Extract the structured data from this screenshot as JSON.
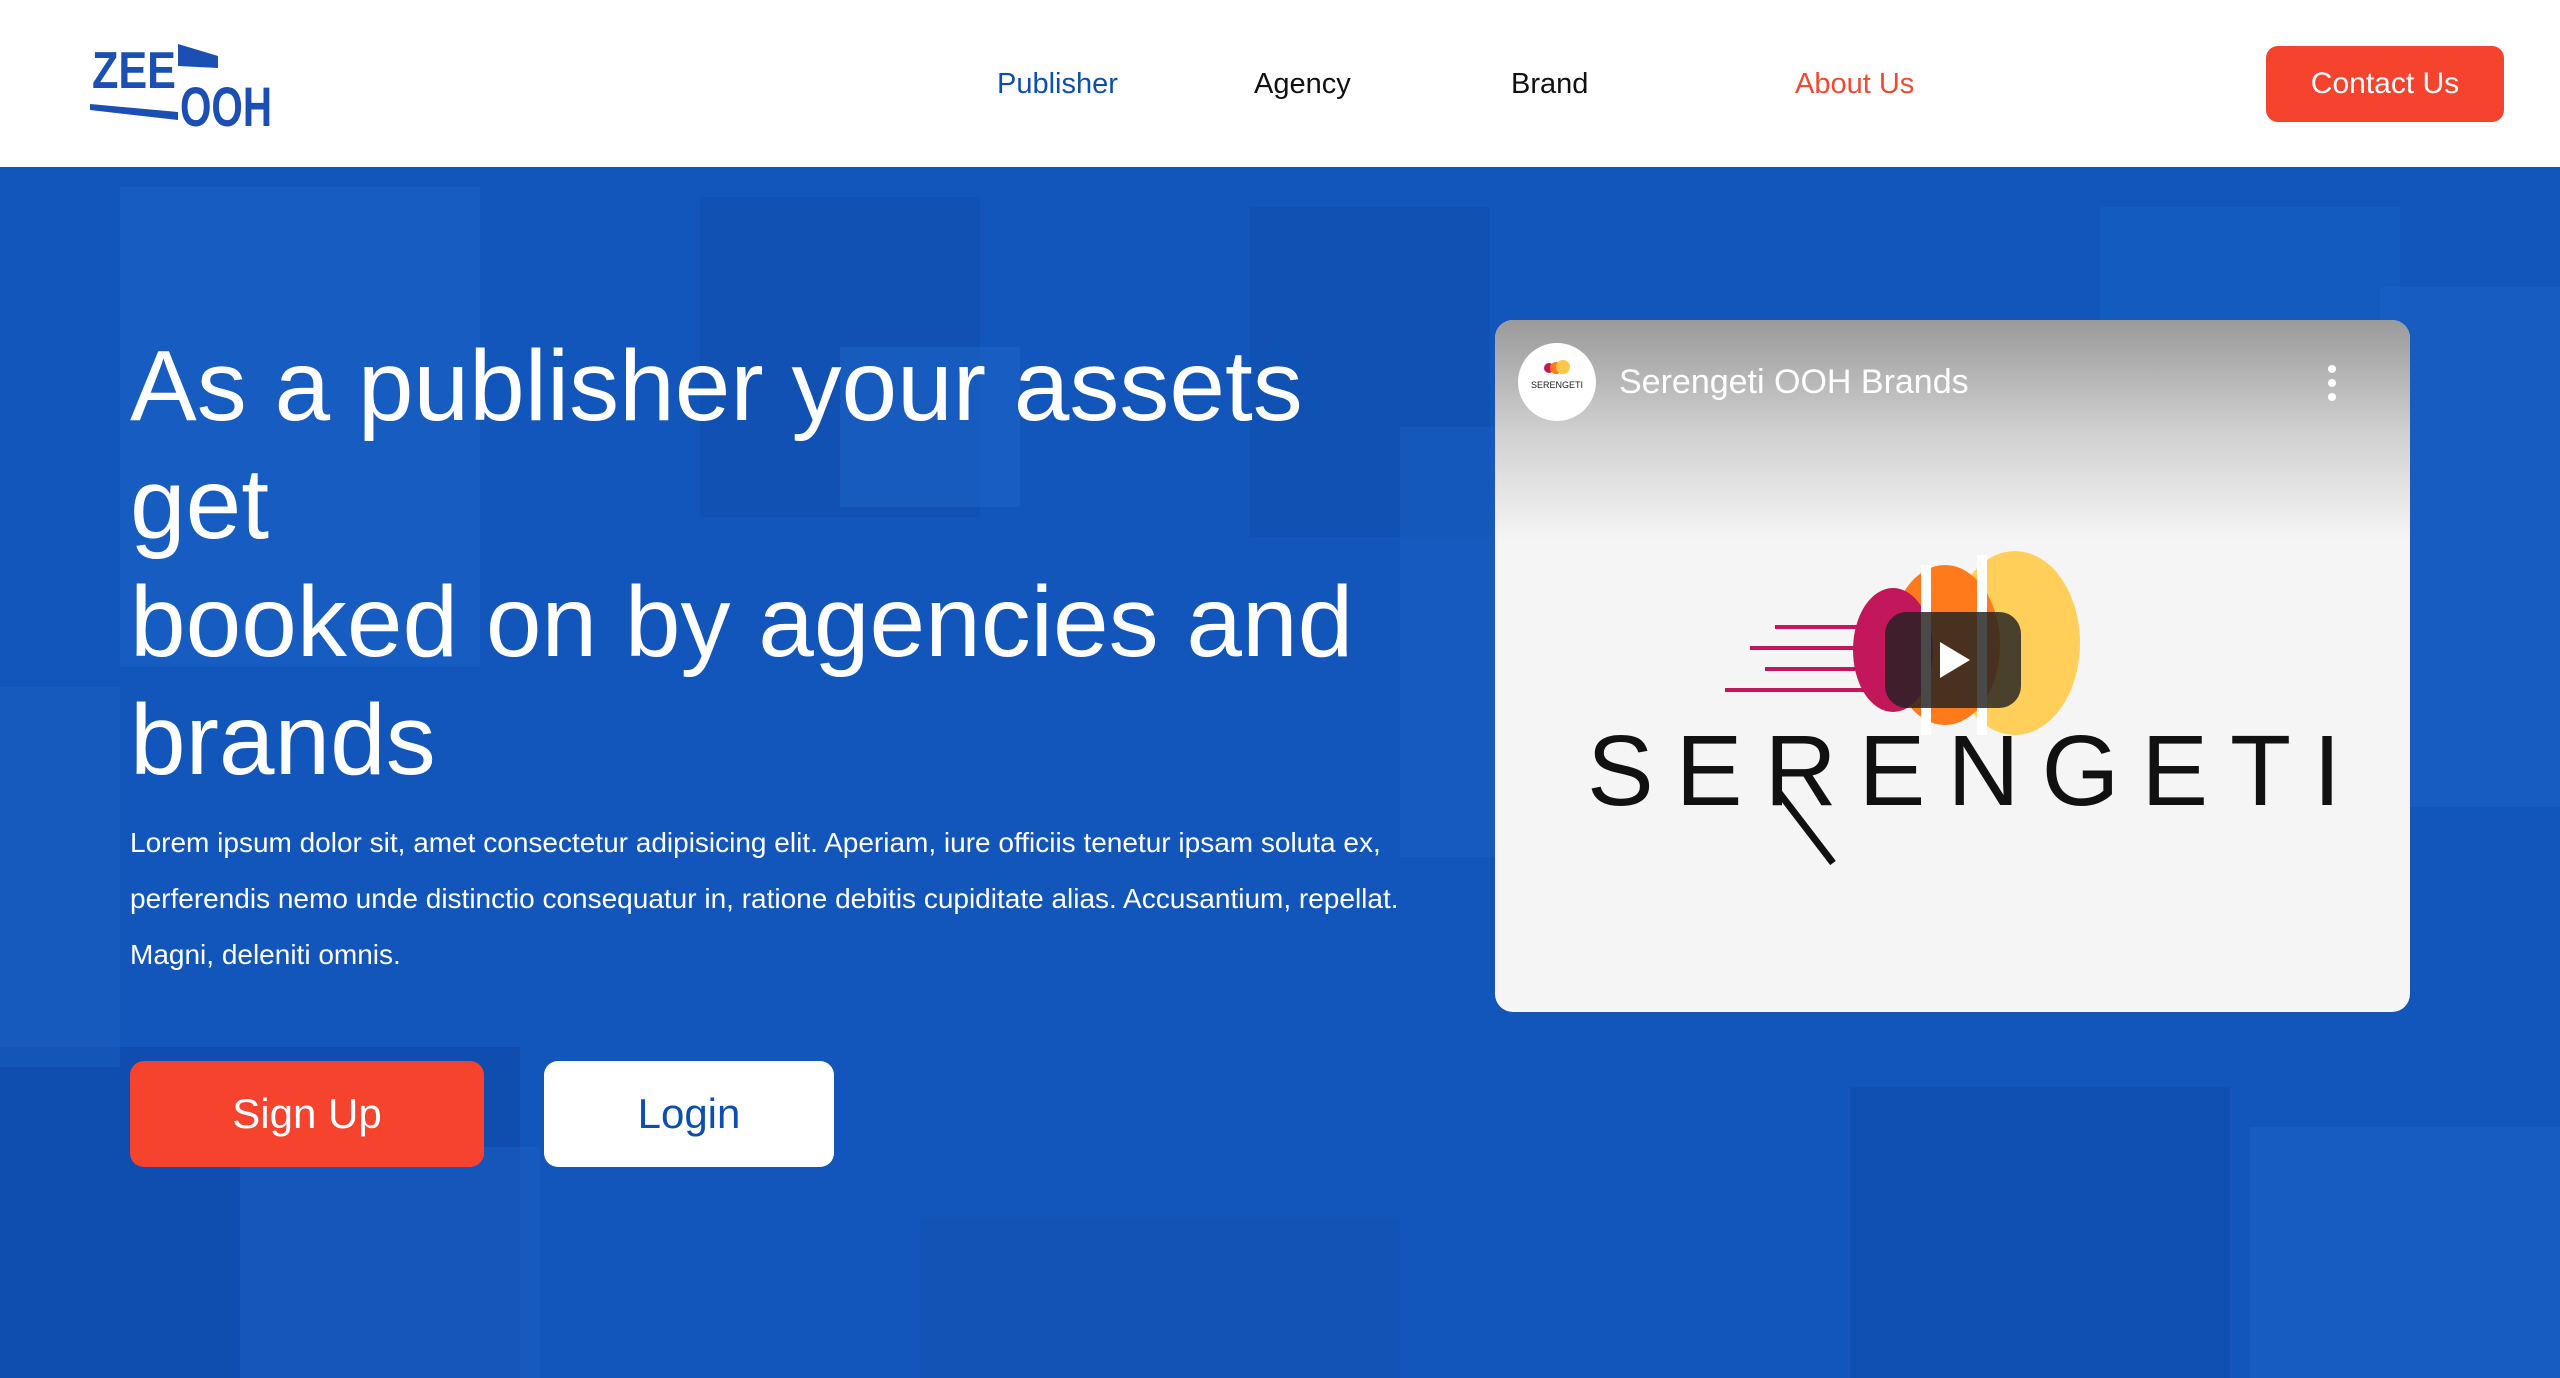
{
  "header": {
    "logo": {
      "line1": "ZEE",
      "line2": "OOH"
    },
    "nav": {
      "publisher": "Publisher",
      "agency": "Agency",
      "brand": "Brand",
      "about": "About Us"
    },
    "contact_label": "Contact Us"
  },
  "hero": {
    "title_line1": "As a publisher your assets get",
    "title_line2": "booked on by agencies and brands",
    "description": "Lorem ipsum dolor sit, amet consectetur adipisicing elit. Aperiam, iure officiis tenetur ipsam soluta ex, perferendis nemo unde distinctio consequatur in, ratione debitis cupiditate alias. Accusantium, repellat. Magni, deleniti omnis.",
    "signup_label": "Sign Up",
    "login_label": "Login"
  },
  "video": {
    "title": "Serengeti OOH Brands",
    "channel_avatar_text": "SERENGETI",
    "logo_text": "SERENGETI",
    "icons": [
      "play-icon",
      "more-vertical-icon"
    ]
  },
  "colors": {
    "brand_blue": "#0d4fae",
    "hero_blue": "#1154b6",
    "accent_red": "#f5432e",
    "about_red": "#f04a33"
  }
}
